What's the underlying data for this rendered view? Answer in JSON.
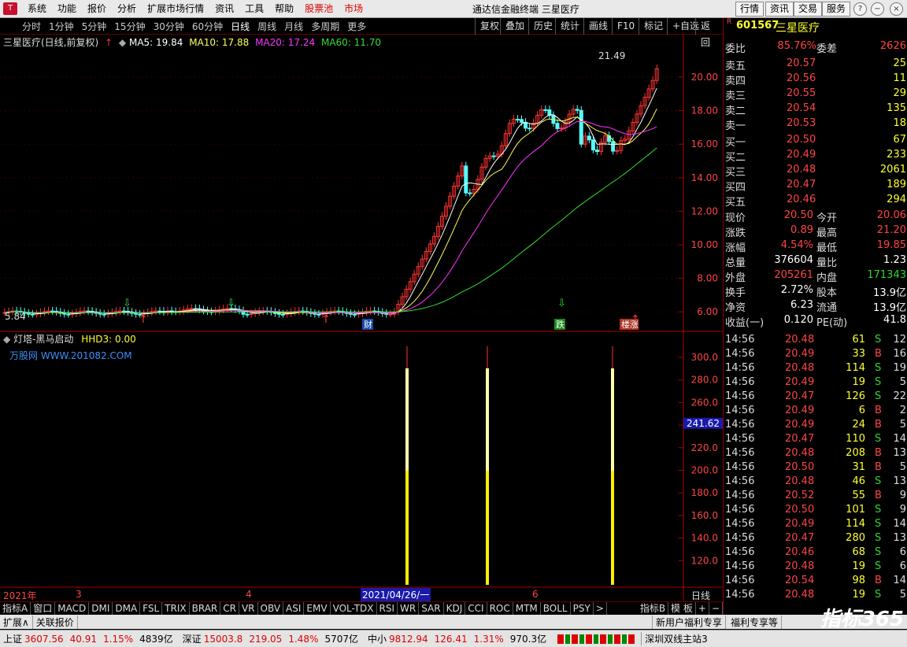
{
  "menubar": {
    "items": [
      "系统",
      "功能",
      "报价",
      "分析",
      "扩展市场行情",
      "资讯",
      "工具",
      "帮助"
    ],
    "red_items": [
      "股票池",
      "市场"
    ],
    "title": "通达信金融终端  三星医疗",
    "right_buttons": [
      "行情",
      "资讯",
      "交易",
      "服务"
    ]
  },
  "periods": [
    "分时",
    "1分钟",
    "5分钟",
    "15分钟",
    "30分钟",
    "60分钟",
    "日线",
    "周线",
    "月线",
    "多周期",
    "更多"
  ],
  "chart_buttons": [
    "复权",
    "叠加",
    "历史",
    "统计",
    "画线",
    "F10",
    "标记",
    "+自选",
    "返回"
  ],
  "main_info": {
    "name": "三星医疗(日线,前复权)",
    "ma5": "MA5: 19.84",
    "ma10": "MA10: 17.88",
    "ma20": "MA20: 17.24",
    "ma60": "MA60: 11.70"
  },
  "price_axis": [
    "20.00",
    "18.00",
    "16.00",
    "14.00",
    "12.00",
    "10.00",
    "8.00",
    "6.00"
  ],
  "annotations": {
    "high_label": "21.49",
    "low_label": "5.84",
    "tag1": "财",
    "tag2": "跌",
    "tag3": "楼涨"
  },
  "indicator": {
    "name": "灯塔-黑马启动",
    "value": "HHD3: 0.00",
    "watermark": "万股网 WWW.201082.COM",
    "axis": [
      "300.0",
      "280.0",
      "260.0",
      "240.0",
      "220.0",
      "200.0",
      "180.0",
      "160.0",
      "140.0",
      "120.0"
    ],
    "current_value": "241.62"
  },
  "time_axis": {
    "labels": [
      "2021年",
      "3",
      "4",
      "6"
    ],
    "cursor": "2021/04/26/一",
    "period": "日线"
  },
  "quote": {
    "code": "601567",
    "name": "三星医疗",
    "r_badge": "R",
    "weibi_label": "委比",
    "weibi": "85.76%",
    "weicha_label": "委差",
    "weicha": "2626",
    "asks": [
      {
        "label": "卖五",
        "price": "20.57",
        "vol": "25"
      },
      {
        "label": "卖四",
        "price": "20.56",
        "vol": "11"
      },
      {
        "label": "卖三",
        "price": "20.55",
        "vol": "29"
      },
      {
        "label": "卖二",
        "price": "20.54",
        "vol": "135"
      },
      {
        "label": "卖一",
        "price": "20.53",
        "vol": "18"
      }
    ],
    "bids": [
      {
        "label": "买一",
        "price": "20.50",
        "vol": "67"
      },
      {
        "label": "买二",
        "price": "20.49",
        "vol": "233"
      },
      {
        "label": "买三",
        "price": "20.48",
        "vol": "2061"
      },
      {
        "label": "买四",
        "price": "20.47",
        "vol": "189"
      },
      {
        "label": "买五",
        "price": "20.46",
        "vol": "294"
      }
    ],
    "stats": [
      {
        "l1": "现价",
        "v1": "20.50",
        "l2": "今开",
        "v2": "20.06"
      },
      {
        "l1": "涨跌",
        "v1": "0.89",
        "l2": "最高",
        "v2": "21.20"
      },
      {
        "l1": "涨幅",
        "v1": "4.54%",
        "l2": "最低",
        "v2": "19.85"
      },
      {
        "l1": "总量",
        "v1": "376604",
        "l2": "量比",
        "v2": "1.23"
      },
      {
        "l1": "外盘",
        "v1": "205261",
        "l2": "内盘",
        "v2": "171343"
      },
      {
        "l1": "换手",
        "v1": "2.72%",
        "l2": "股本",
        "v2": "13.9亿"
      },
      {
        "l1": "净资",
        "v1": "6.23",
        "l2": "流通",
        "v2": "13.9亿"
      },
      {
        "l1": "收益(一)",
        "v1": "0.120",
        "l2": "PE(动)",
        "v2": "41.8"
      }
    ],
    "ticks": [
      [
        "14:56",
        "20.48",
        "61",
        "S",
        "12"
      ],
      [
        "14:56",
        "20.49",
        "33",
        "B",
        "16"
      ],
      [
        "14:56",
        "20.48",
        "114",
        "S",
        "19"
      ],
      [
        "14:56",
        "20.49",
        "19",
        "S",
        "5"
      ],
      [
        "14:56",
        "20.47",
        "126",
        "S",
        "22"
      ],
      [
        "14:56",
        "20.49",
        "6",
        "B",
        "2"
      ],
      [
        "14:56",
        "20.49",
        "24",
        "B",
        "5"
      ],
      [
        "14:56",
        "20.47",
        "110",
        "S",
        "14"
      ],
      [
        "14:56",
        "20.48",
        "208",
        "B",
        "13"
      ],
      [
        "14:56",
        "20.50",
        "31",
        "B",
        "5"
      ],
      [
        "14:56",
        "20.48",
        "46",
        "S",
        "13"
      ],
      [
        "14:56",
        "20.52",
        "55",
        "B",
        "9"
      ],
      [
        "14:56",
        "20.50",
        "101",
        "S",
        "9"
      ],
      [
        "14:56",
        "20.49",
        "114",
        "S",
        "14"
      ],
      [
        "14:56",
        "20.47",
        "280",
        "S",
        "13"
      ],
      [
        "14:56",
        "20.46",
        "68",
        "S",
        "6"
      ],
      [
        "14:56",
        "20.48",
        "19",
        "S",
        "6"
      ],
      [
        "14:56",
        "20.54",
        "98",
        "B",
        "14"
      ],
      [
        "14:56",
        "20.48",
        "19",
        "S",
        "5"
      ]
    ]
  },
  "bottom_tabs": [
    "指标A",
    "窗口",
    "MACD",
    "DMI",
    "DMA",
    "FSL",
    "TRIX",
    "BRAR",
    "CR",
    "VR",
    "OBV",
    "ASI",
    "EMV",
    "VOL-TDX",
    "RSI",
    "WR",
    "SAR",
    "KDJ",
    "CCI",
    "ROC",
    "MTM",
    "BOLL",
    "PSY",
    ">"
  ],
  "bottom_right": [
    "指标B",
    "模 板",
    "+",
    "−"
  ],
  "status1": [
    "扩展∧",
    "关联报价"
  ],
  "status1_right": [
    "新用户福利专享",
    "福利专享等"
  ],
  "status2": {
    "sh_label": "上证",
    "sh_val": "3607.56",
    "sh_chg": "40.91",
    "sh_pct": "1.15%",
    "sh_amt": "4839亿",
    "sz_label": "深证",
    "sz_val": "15003.8",
    "sz_chg": "219.05",
    "sz_pct": "1.48%",
    "sz_amt": "5707亿",
    "zx_label": "中小",
    "zx_val": "9812.94",
    "zx_chg": "126.41",
    "zx_pct": "1.31%",
    "zx_amt": "970.3亿",
    "server": "深圳双线主站3"
  },
  "brand": "指标365",
  "colors": {
    "up": "#ff3333",
    "down": "#54ffff",
    "ma5": "#ffffff",
    "ma10": "#ffff55",
    "ma20": "#ff33ff",
    "ma60": "#33dd33"
  }
}
